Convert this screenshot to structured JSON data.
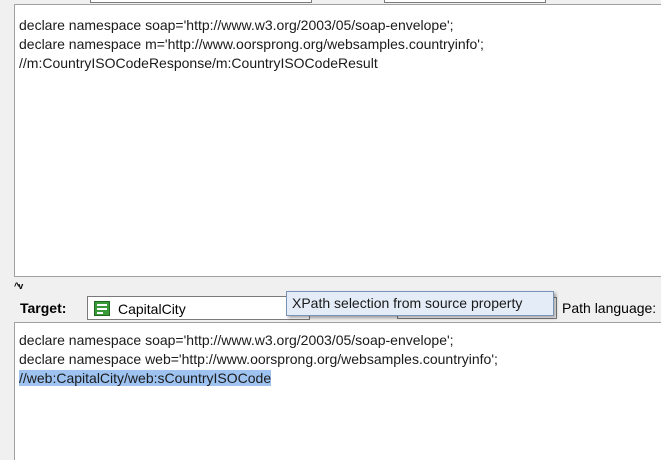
{
  "source_editor": {
    "lines": [
      "declare namespace soap='http://www.w3.org/2003/05/soap-envelope';",
      "declare namespace m='http://www.oorsprong.org/websamples.countryinfo';",
      "//m:CountryISOCodeResponse/m:CountryISOCodeResult"
    ]
  },
  "splitter": {
    "arrows": "^v"
  },
  "target_bar": {
    "label": "Target:",
    "selected_step": "CapitalCity",
    "path_language_label": "Path language:"
  },
  "tooltip": {
    "text": "XPath selection from source property"
  },
  "target_editor": {
    "lines": [
      "declare namespace soap='http://www.w3.org/2003/05/soap-envelope';",
      "declare namespace web='http://www.oorsprong.org/websamples.countryinfo';",
      "//web:CapitalCity/web:sCountryISOCode"
    ]
  },
  "colors": {
    "selection": "#9ec3f0",
    "step_icon": "#3a9a3a",
    "tooltip_bg": "#e4ecf7"
  }
}
